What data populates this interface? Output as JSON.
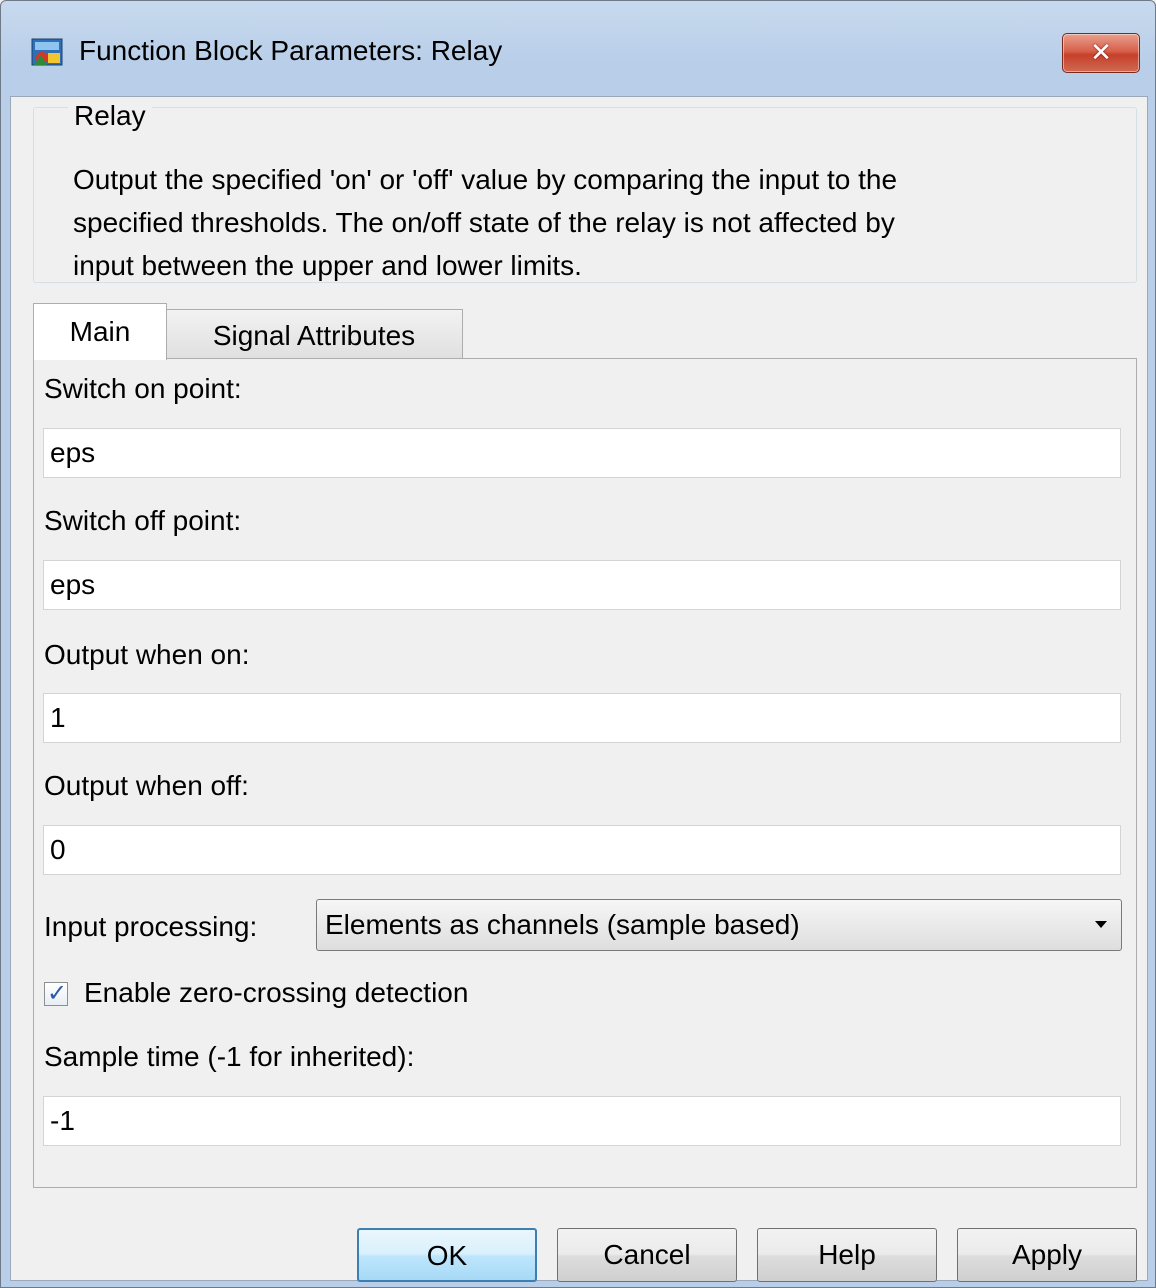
{
  "window": {
    "title": "Function Block Parameters: Relay",
    "close_label": "✕"
  },
  "block": {
    "name": "Relay",
    "description": "Output the specified 'on' or 'off' value by comparing the input to the\nspecified thresholds.  The on/off state of the relay is not affected by\ninput between the upper and lower limits."
  },
  "tabs": [
    {
      "label": "Main",
      "selected": true
    },
    {
      "label": "Signal Attributes",
      "selected": false
    }
  ],
  "params": {
    "switch_on": {
      "label": "Switch on point:",
      "value": "eps"
    },
    "switch_off": {
      "label": "Switch off point:",
      "value": "eps"
    },
    "output_on": {
      "label": "Output when on:",
      "value": "1"
    },
    "output_off": {
      "label": "Output when off:",
      "value": "0"
    },
    "input_processing": {
      "label": "Input processing:",
      "value": "Elements as channels (sample based)"
    },
    "zero_crossing": {
      "label": "Enable zero-crossing detection",
      "checked": true
    },
    "sample_time": {
      "label": "Sample time (-1 for inherited):",
      "value": "-1"
    }
  },
  "buttons": {
    "ok": "OK",
    "cancel": "Cancel",
    "help": "Help",
    "apply": "Apply"
  },
  "icons": {
    "app": "simulink-block-icon",
    "close": "close-icon",
    "dropdown": "chevron-down-icon",
    "check": "checkmark-icon"
  },
  "colors": {
    "titlebar": "#b9cfe9",
    "close_button": "#c7402a",
    "default_button_border": "#3c7fb1",
    "checkmark": "#2a5aa8"
  }
}
